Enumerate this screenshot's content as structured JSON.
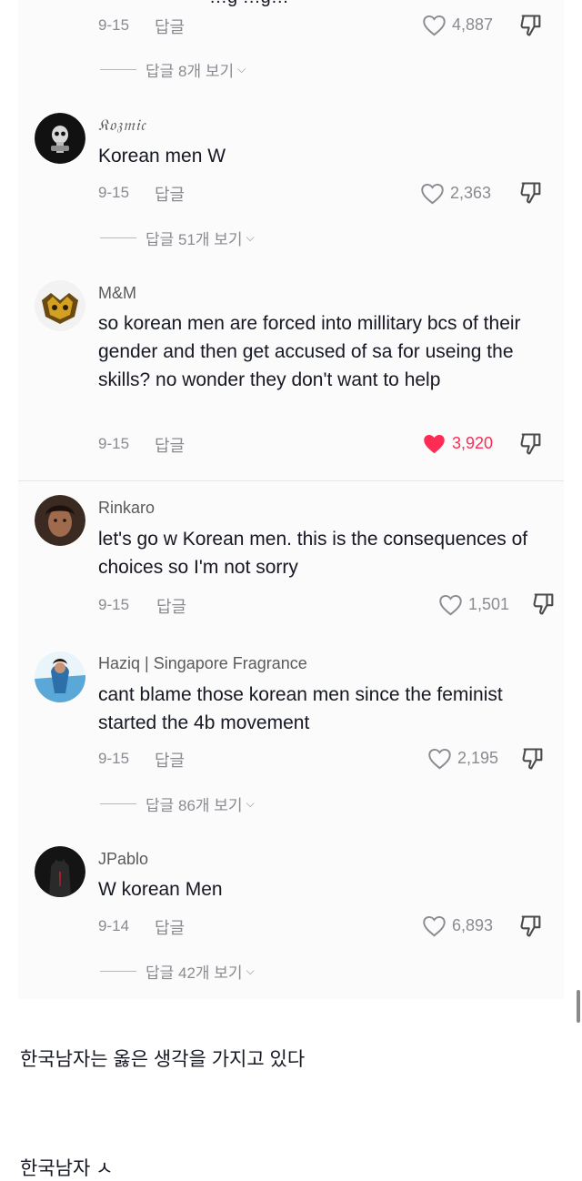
{
  "top_comment": {
    "cropped_text": "…g …g…",
    "date": "9-15",
    "reply_label": "답글",
    "likes": "4,887",
    "view_replies": "답글 8개 보기"
  },
  "comments": [
    {
      "username": "𝔎𝔬𝔷𝔪𝔦𝔠",
      "text": "Korean men W",
      "date": "9-15",
      "reply_label": "답글",
      "likes": "2,363",
      "liked": false,
      "view_replies": "답글 51개 보기"
    },
    {
      "username": "M&M",
      "text": "so korean men are forced into millitary bcs of their gender and then get accused of sa for useing the skills? no wonder they don't want to help",
      "date": "9-15",
      "reply_label": "답글",
      "likes": "3,920",
      "liked": true,
      "view_replies": ""
    },
    {
      "username": "Rinkaro",
      "text": "let's go w Korean men. this is the consequences of choices so I'm not sorry",
      "date": "9-15",
      "reply_label": "답글",
      "likes": "1,501",
      "liked": false,
      "view_replies": ""
    },
    {
      "username": "Haziq | Singapore Fragrance",
      "text": "cant blame those korean men since the feminist started the 4b movement",
      "date": "9-15",
      "reply_label": "답글",
      "likes": "2,195",
      "liked": false,
      "view_replies": "답글 86개 보기"
    },
    {
      "username": "JPablo",
      "text": "W korean Men",
      "date": "9-14",
      "reply_label": "답글",
      "likes": "6,893",
      "liked": false,
      "view_replies": "답글 42개 보기"
    }
  ],
  "post": {
    "caption": "한국남자는 옳은 생각을 가지고 있다",
    "cut_line": "한국남자 ㅅ"
  },
  "colors": {
    "like_active": "#fe2c55",
    "meta_gray": "#8a8b91",
    "text": "#161823"
  },
  "icons": {
    "like": "heart-outline-icon",
    "liked": "heart-filled-icon",
    "dislike": "thumbs-down-icon",
    "expand": "chevron-down-icon"
  }
}
